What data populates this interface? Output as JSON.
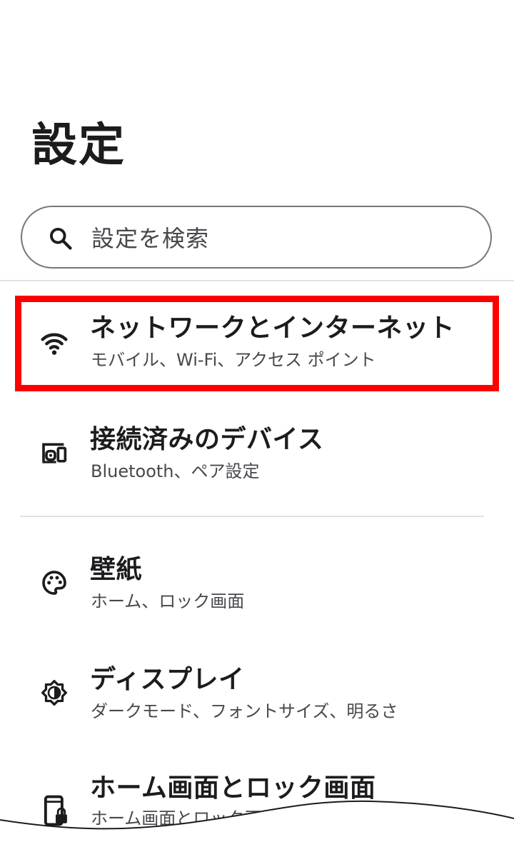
{
  "header": {
    "title": "設定"
  },
  "search": {
    "placeholder": "設定を検索"
  },
  "items": [
    {
      "title": "ネットワークとインターネット",
      "subtitle": "モバイル、Wi-Fi、アクセス ポイント",
      "icon": "wifi-icon"
    },
    {
      "title": "接続済みのデバイス",
      "subtitle": "Bluetooth、ペア設定",
      "icon": "connected-devices-icon"
    },
    {
      "title": "壁紙",
      "subtitle": "ホーム、ロック画面",
      "icon": "palette-icon"
    },
    {
      "title": "ディスプレイ",
      "subtitle": "ダークモード、フォントサイズ、明るさ",
      "icon": "brightness-icon"
    },
    {
      "title": "ホーム画面とロック画面",
      "subtitle": "ホーム画面とロック画面",
      "icon": "phone-lock-icon"
    }
  ],
  "colors": {
    "highlight": "#ff0000",
    "text_primary": "#1b1c1e",
    "text_secondary": "#46484c",
    "divider": "#e2e2e4"
  }
}
